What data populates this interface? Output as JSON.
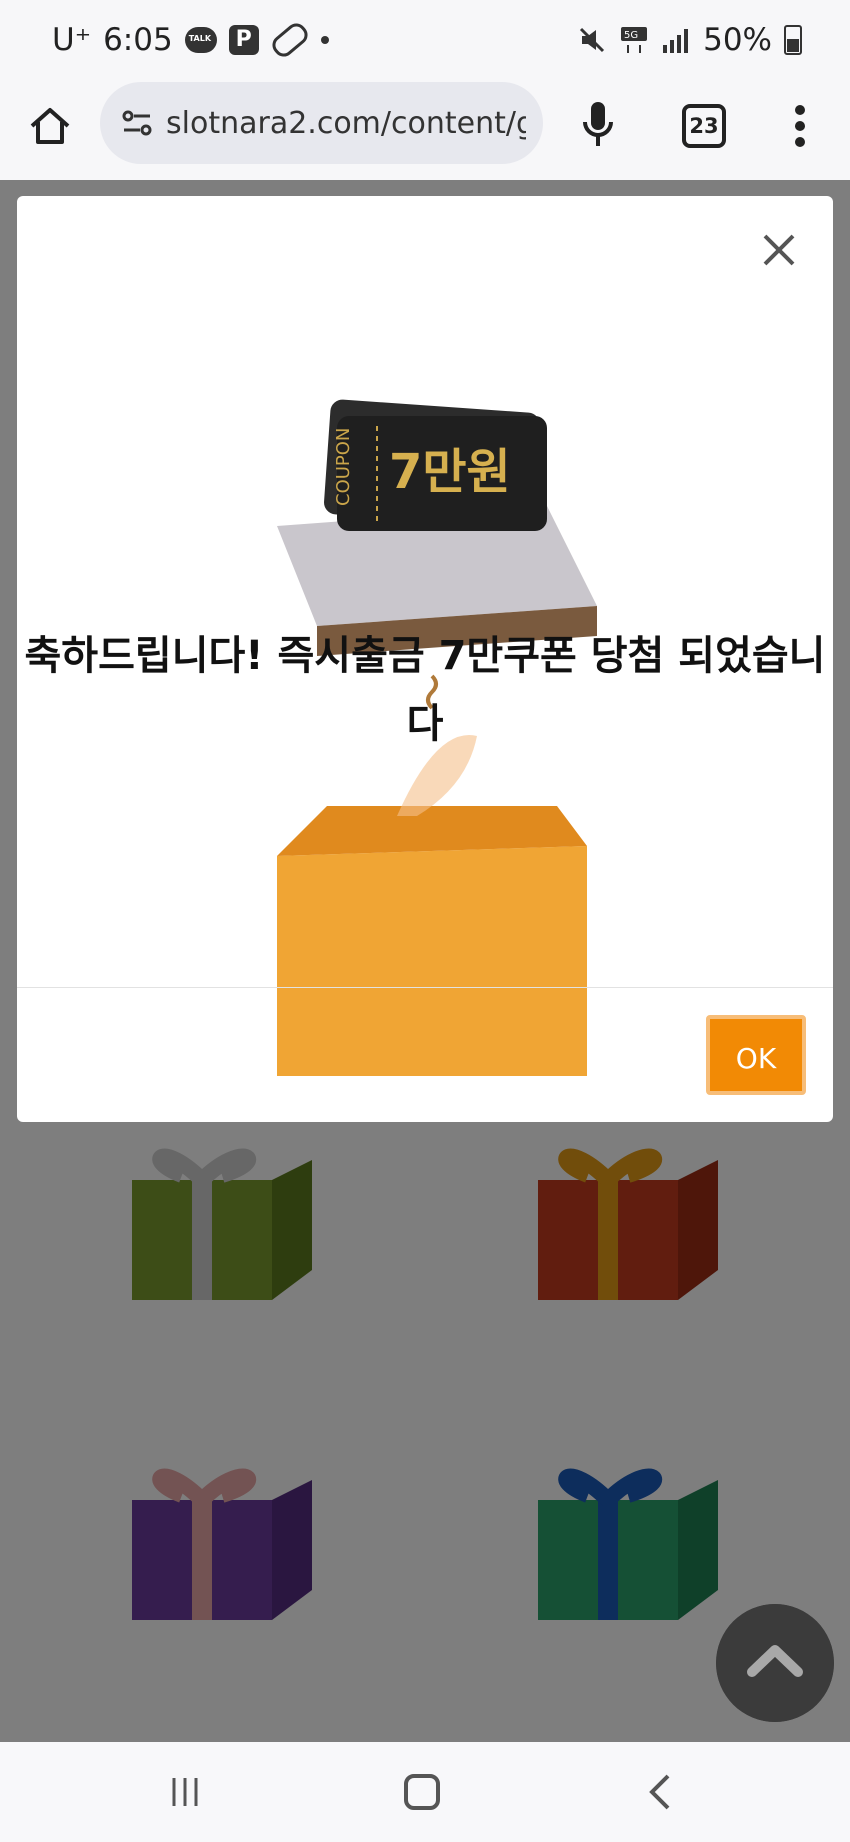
{
  "status_bar": {
    "carrier": "U⁺",
    "time": "6:05",
    "battery": "50%",
    "icons": [
      "talk-icon",
      "p-icon",
      "pill-icon",
      "dot-icon",
      "mute-icon",
      "5g-icon",
      "signal-icon",
      "battery-icon"
    ]
  },
  "browser": {
    "url": "slotnara2.com/content/g",
    "tab_count": "23"
  },
  "modal": {
    "message": "축하드립니다! 즉시출금 7만쿠폰 당첨 되었습니다",
    "ok_label": "OK",
    "coupon_label": "COUPON",
    "coupon_value": "7만원"
  },
  "gifts": [
    {
      "color": "#7a9a2e",
      "ribbon": "#cfcfcf"
    },
    {
      "color": "#c23a1e",
      "ribbon": "#e39a16"
    },
    {
      "color": "#6a3b9c",
      "ribbon": "#e7a7a7"
    },
    {
      "color": "#2aa06a",
      "ribbon": "#1b5ab8"
    }
  ],
  "colors": {
    "accent": "#f28a05",
    "overlay": "rgba(0,0,0,0.5)"
  }
}
